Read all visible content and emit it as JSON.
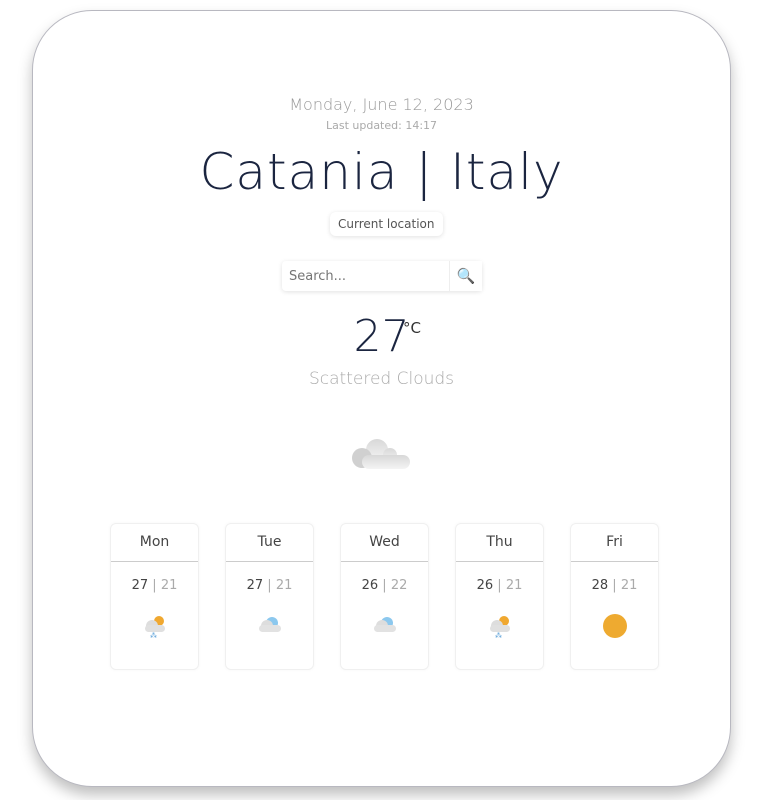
{
  "date": "Monday, June 12, 2023",
  "last_updated": "Last updated: 14:17",
  "city": "Catania | Italy",
  "current_location_label": "Current location",
  "search": {
    "placeholder": "Search...",
    "icon": "magnifier-icon"
  },
  "current": {
    "temp": "27",
    "unit": "°C",
    "description": "Scattered Clouds",
    "icon": "scattered-clouds"
  },
  "forecast": [
    {
      "day": "Mon",
      "high": "27",
      "low": "21",
      "icon": "sun-cloud-rain"
    },
    {
      "day": "Tue",
      "high": "27",
      "low": "21",
      "icon": "clouds"
    },
    {
      "day": "Wed",
      "high": "26",
      "low": "22",
      "icon": "clouds"
    },
    {
      "day": "Thu",
      "high": "26",
      "low": "21",
      "icon": "sun-cloud-rain"
    },
    {
      "day": "Fri",
      "high": "28",
      "low": "21",
      "icon": "sun"
    }
  ],
  "separator": "|"
}
